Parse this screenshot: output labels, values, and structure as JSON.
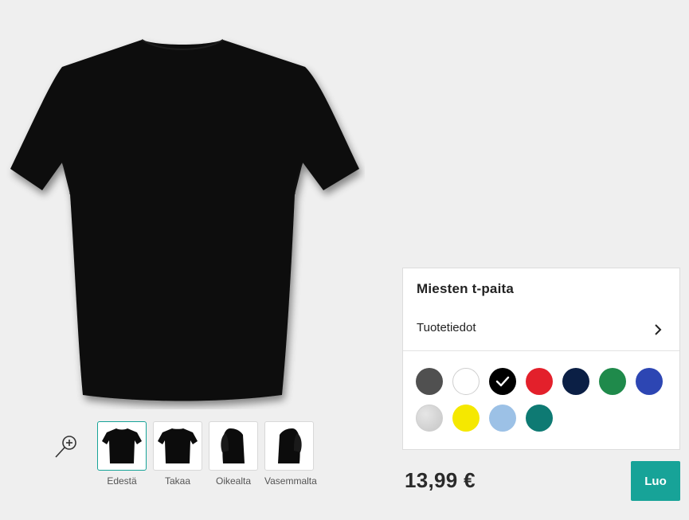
{
  "product": {
    "title": "Miesten t-paita",
    "info_label": "Tuotetiedot",
    "price": "13,99 €",
    "create_label": "Luo"
  },
  "views": [
    {
      "label": "Edestä",
      "icon": "tshirt-front-icon",
      "selected": true
    },
    {
      "label": "Takaa",
      "icon": "tshirt-back-icon",
      "selected": false
    },
    {
      "label": "Oikealta",
      "icon": "tshirt-right-side-icon",
      "selected": false
    },
    {
      "label": "Vasemmalta",
      "icon": "tshirt-left-side-icon",
      "selected": false
    }
  ],
  "colors": [
    {
      "name": "dark-grey",
      "hex": "#505050",
      "selected": false
    },
    {
      "name": "white",
      "hex": "#ffffff",
      "selected": false
    },
    {
      "name": "black",
      "hex": "#000000",
      "selected": true
    },
    {
      "name": "red",
      "hex": "#e3202b",
      "selected": false
    },
    {
      "name": "navy",
      "hex": "#0b1f45",
      "selected": false
    },
    {
      "name": "green",
      "hex": "#1f8a4b",
      "selected": false
    },
    {
      "name": "royal-blue",
      "hex": "#2d46b3",
      "selected": false
    },
    {
      "name": "heather-grey",
      "hex": "#d4d4d4",
      "selected": false
    },
    {
      "name": "yellow",
      "hex": "#f5e800",
      "selected": false
    },
    {
      "name": "light-blue",
      "hex": "#9cc1e6",
      "selected": false
    },
    {
      "name": "teal",
      "hex": "#0e7a73",
      "selected": false
    }
  ],
  "accent": "#17a398",
  "zoom_icon": "zoom-in-icon"
}
